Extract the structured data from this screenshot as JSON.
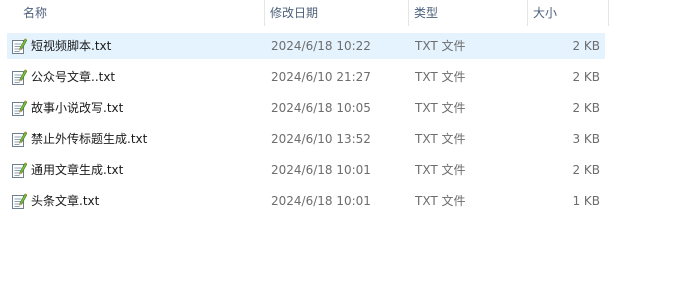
{
  "columns": {
    "name": "名称",
    "date": "修改日期",
    "type": "类型",
    "size": "大小"
  },
  "sort": {
    "column": "name",
    "icon": "sort-up-chevron"
  },
  "files": [
    {
      "name": "短视频脚本.txt",
      "date": "2024/6/18 10:22",
      "type": "TXT 文件",
      "size": "2 KB",
      "selected": true
    },
    {
      "name": "公众号文章..txt",
      "date": "2024/6/10 21:27",
      "type": "TXT 文件",
      "size": "2 KB",
      "selected": false
    },
    {
      "name": "故事小说改写.txt",
      "date": "2024/6/18 10:05",
      "type": "TXT 文件",
      "size": "2 KB",
      "selected": false
    },
    {
      "name": "禁止外传标题生成.txt",
      "date": "2024/6/10 13:52",
      "type": "TXT 文件",
      "size": "3 KB",
      "selected": false
    },
    {
      "name": "通用文章生成.txt",
      "date": "2024/6/18 10:01",
      "type": "TXT 文件",
      "size": "2 KB",
      "selected": false
    },
    {
      "name": "头条文章.txt",
      "date": "2024/6/18 10:01",
      "type": "TXT 文件",
      "size": "1 KB",
      "selected": false
    }
  ],
  "colors": {
    "selection": "#e5f3ff",
    "header_text": "#4c607a",
    "secondary_text": "#6d6d6d"
  }
}
